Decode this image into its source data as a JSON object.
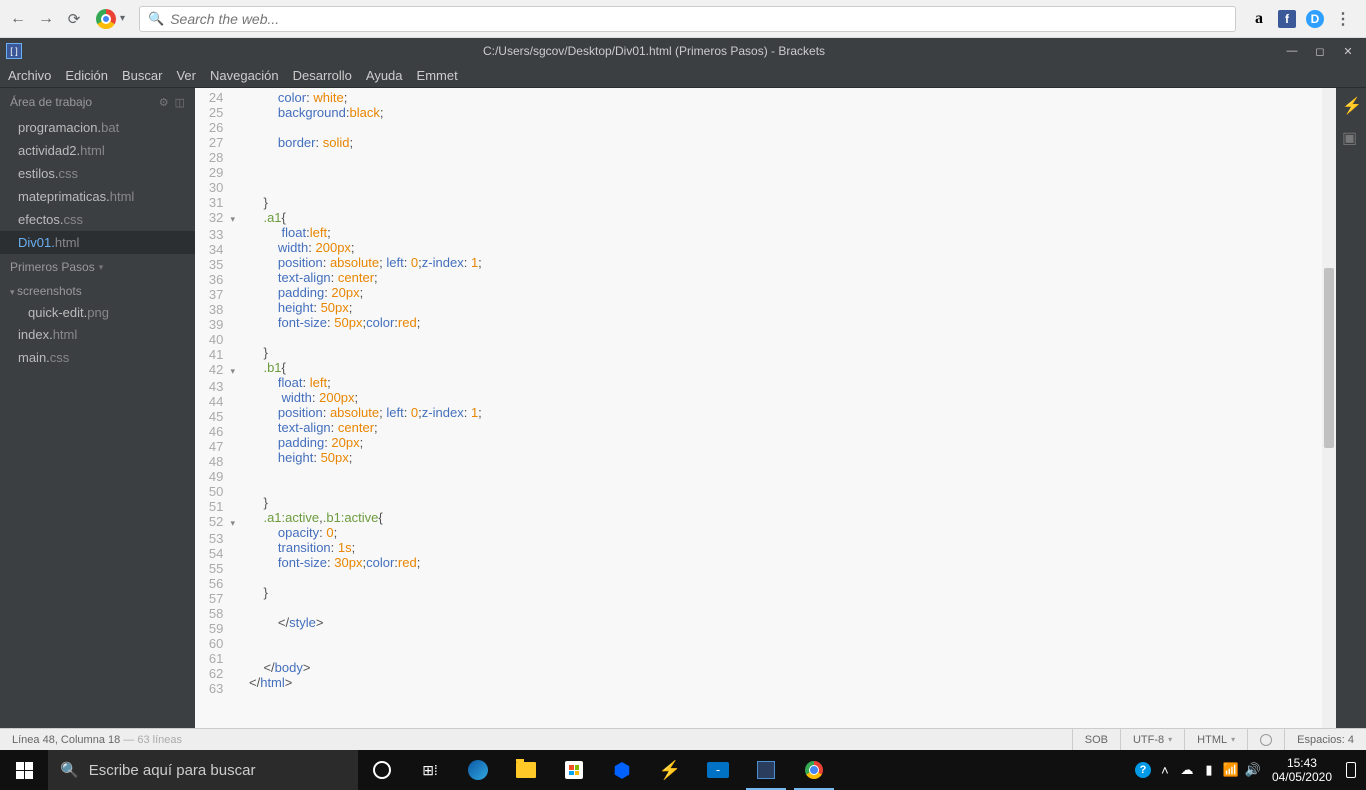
{
  "browser": {
    "search_placeholder": "Search the web..."
  },
  "titlebar": {
    "title": "C:/Users/sgcov/Desktop/Div01.html (Primeros Pasos) - Brackets"
  },
  "menu": {
    "items": [
      "Archivo",
      "Edición",
      "Buscar",
      "Ver",
      "Navegación",
      "Desarrollo",
      "Ayuda",
      "Emmet"
    ]
  },
  "sidebar": {
    "working_label": "Área de trabajo",
    "working_files": [
      {
        "name": "programacion.",
        "ext": "bat"
      },
      {
        "name": "actividad2.",
        "ext": "html"
      },
      {
        "name": "estilos.",
        "ext": "css"
      },
      {
        "name": "mateprimaticas.",
        "ext": "html"
      },
      {
        "name": "efectos.",
        "ext": "css"
      },
      {
        "name": "Div01.",
        "ext": "html",
        "active": true
      }
    ],
    "project_label": "Primeros Pasos",
    "folder": "screenshots",
    "folder_files": [
      {
        "name": "quick-edit.",
        "ext": "png"
      }
    ],
    "project_files": [
      {
        "name": "index.",
        "ext": "html"
      },
      {
        "name": "main.",
        "ext": "css"
      }
    ]
  },
  "editor": {
    "first_line": 24,
    "code_lines": [
      {
        "n": 24,
        "html": "        <span class='kw'>color</span>: <span class='val'>white</span>;"
      },
      {
        "n": 25,
        "html": "        <span class='kw'>background</span>:<span class='val'>black</span>;"
      },
      {
        "n": 26,
        "html": ""
      },
      {
        "n": 27,
        "html": "        <span class='kw'>border</span>: <span class='val'>solid</span>;"
      },
      {
        "n": 28,
        "html": ""
      },
      {
        "n": 29,
        "html": ""
      },
      {
        "n": 30,
        "html": ""
      },
      {
        "n": 31,
        "html": "    }"
      },
      {
        "n": 32,
        "fold": "▾",
        "html": "    <span class='sel'>.a1</span>{"
      },
      {
        "n": 33,
        "html": "         <span class='kw'>float</span>:<span class='val'>left</span>;"
      },
      {
        "n": 34,
        "html": "        <span class='kw'>width</span>: <span class='val'>200px</span>;"
      },
      {
        "n": 35,
        "html": "        <span class='kw'>position</span>: <span class='val'>absolute</span>; <span class='kw'>left</span>: <span class='val'>0</span>;<span class='kw'>z-index</span>: <span class='val'>1</span>;"
      },
      {
        "n": 36,
        "html": "        <span class='kw'>text-align</span>: <span class='val'>center</span>;"
      },
      {
        "n": 37,
        "html": "        <span class='kw'>padding</span>: <span class='val'>20px</span>;"
      },
      {
        "n": 38,
        "html": "        <span class='kw'>height</span>: <span class='val'>50px</span>;"
      },
      {
        "n": 39,
        "html": "        <span class='kw'>font-size</span>: <span class='val'>50px</span>;<span class='kw'>color</span>:<span class='val'>red</span>;"
      },
      {
        "n": 40,
        "html": ""
      },
      {
        "n": 41,
        "html": "    }"
      },
      {
        "n": 42,
        "fold": "▾",
        "html": "    <span class='sel'>.b1</span>{"
      },
      {
        "n": 43,
        "html": "        <span class='kw'>float</span>: <span class='val'>left</span>;"
      },
      {
        "n": 44,
        "html": "         <span class='kw'>width</span>: <span class='val'>200px</span>;"
      },
      {
        "n": 45,
        "html": "        <span class='kw'>position</span>: <span class='val'>absolute</span>; <span class='kw'>left</span>: <span class='val'>0</span>;<span class='kw'>z-index</span>: <span class='val'>1</span>;"
      },
      {
        "n": 46,
        "html": "        <span class='kw'>text-align</span>: <span class='val'>center</span>;"
      },
      {
        "n": 47,
        "html": "        <span class='kw'>padding</span>: <span class='val'>20px</span>;"
      },
      {
        "n": 48,
        "html": "        <span class='kw'>height</span>: <span class='val'>50px</span>;"
      },
      {
        "n": 49,
        "html": ""
      },
      {
        "n": 50,
        "html": ""
      },
      {
        "n": 51,
        "html": "    }"
      },
      {
        "n": 52,
        "fold": "▾",
        "html": "    <span class='sel'>.a1:active</span>,<span class='sel'>.b1:active</span>{"
      },
      {
        "n": 53,
        "html": "        <span class='kw'>opacity</span>: <span class='val'>0</span>;"
      },
      {
        "n": 54,
        "html": "        <span class='kw'>transition</span>: <span class='val'>1s</span>;"
      },
      {
        "n": 55,
        "html": "        <span class='kw'>font-size</span>: <span class='val'>30px</span>;<span class='kw'>color</span>:<span class='val'>red</span>;"
      },
      {
        "n": 56,
        "html": ""
      },
      {
        "n": 57,
        "html": "    }"
      },
      {
        "n": 58,
        "html": ""
      },
      {
        "n": 59,
        "html": "        &lt;/<span class='tag'>style</span>&gt;"
      },
      {
        "n": 60,
        "html": ""
      },
      {
        "n": 61,
        "html": ""
      },
      {
        "n": 62,
        "html": "    &lt;/<span class='tag'>body</span>&gt;"
      },
      {
        "n": 63,
        "html": "&lt;/<span class='tag'>html</span>&gt;"
      }
    ]
  },
  "statusbar": {
    "cursor": "Línea 48, Columna 18",
    "lines_suffix": " — 63 líneas",
    "ovr": "SOB",
    "encoding": "UTF-8",
    "lang": "HTML",
    "spaces": "Espacios: 4"
  },
  "taskbar": {
    "search_placeholder": "Escribe aquí para buscar",
    "time": "15:43",
    "date": "04/05/2020"
  }
}
